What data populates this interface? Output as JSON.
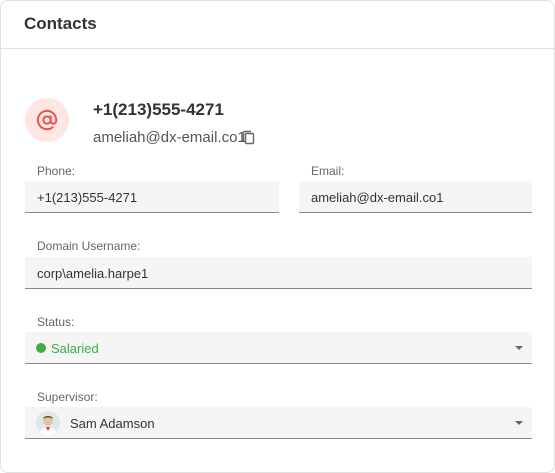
{
  "header": {
    "title": "Contacts"
  },
  "contact": {
    "avatar_icon": "at-sign-icon",
    "phone": "+1(213)555-4271",
    "email": "ameliah@dx-email.co1",
    "copy_icon": "copy-icon"
  },
  "form": {
    "phone": {
      "label": "Phone:",
      "value": "+1(213)555-4271"
    },
    "email": {
      "label": "Email:",
      "value": "ameliah@dx-email.co1"
    },
    "domain_username": {
      "label": "Domain Username:",
      "value": "corp\\amelia.harpe1"
    },
    "status": {
      "label": "Status:",
      "value": "Salaried",
      "color": "#3cae45"
    },
    "supervisor": {
      "label": "Supervisor:",
      "value": "Sam Adamson"
    }
  },
  "colors": {
    "accent": "#e8534a",
    "avatar_bg": "#fde6e3",
    "status_green": "#3cae45"
  }
}
